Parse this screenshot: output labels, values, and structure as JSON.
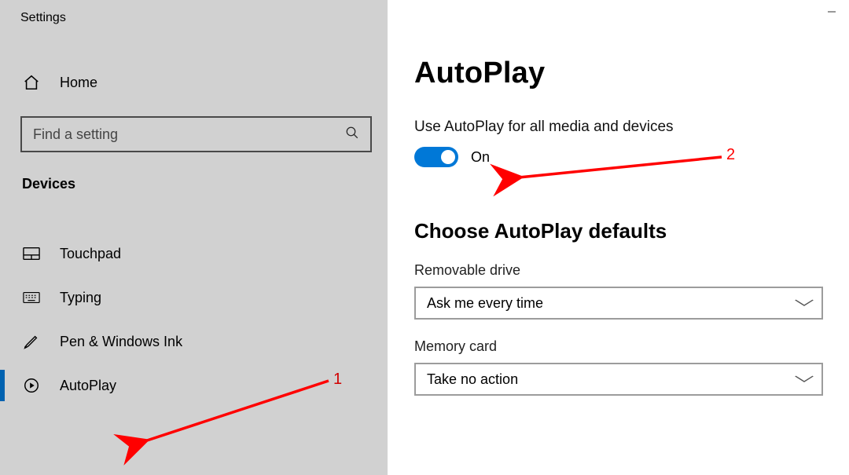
{
  "window_title": "Settings",
  "sidebar": {
    "home_label": "Home",
    "search_placeholder": "Find a setting",
    "category": "Devices",
    "items": [
      {
        "label": "Touchpad",
        "icon": "touchpad",
        "active": false
      },
      {
        "label": "Typing",
        "icon": "keyboard",
        "active": false
      },
      {
        "label": "Pen & Windows Ink",
        "icon": "pen",
        "active": false
      },
      {
        "label": "AutoPlay",
        "icon": "autoplay",
        "active": true
      }
    ]
  },
  "main": {
    "title": "AutoPlay",
    "toggle_section_label": "Use AutoPlay for all media and devices",
    "toggle_state_label": "On",
    "toggle_on": true,
    "defaults_title": "Choose AutoPlay defaults",
    "fields": [
      {
        "label": "Removable drive",
        "value": "Ask me every time"
      },
      {
        "label": "Memory card",
        "value": "Take no action"
      }
    ]
  },
  "annotations": {
    "n1": "1",
    "n2": "2"
  },
  "colors": {
    "accent": "#0078d7",
    "annotation": "#ff0000"
  }
}
